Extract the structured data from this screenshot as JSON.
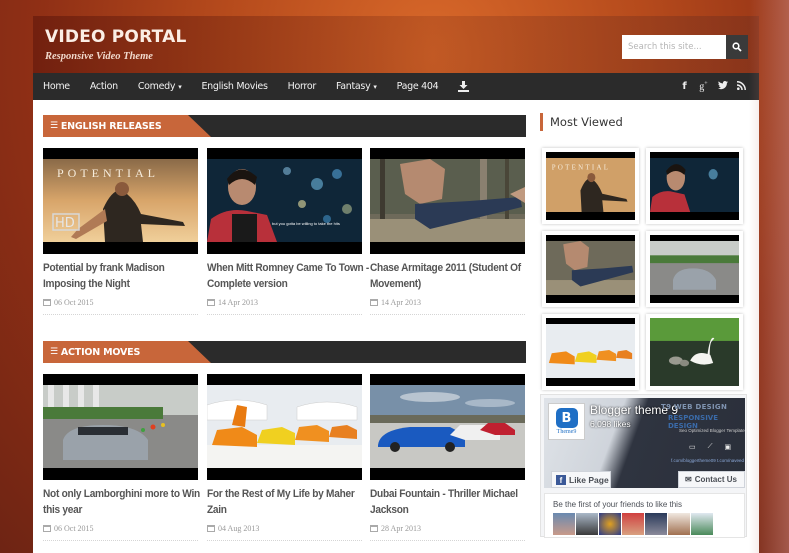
{
  "header": {
    "title": "VIDEO PORTAL",
    "tagline": "Responsive Video Theme",
    "search": {
      "placeholder": "Search this site...",
      "icon": "search-icon"
    }
  },
  "nav": {
    "items": [
      {
        "label": "Home",
        "dropdown": false
      },
      {
        "label": "Action",
        "dropdown": false
      },
      {
        "label": "Comedy",
        "dropdown": true
      },
      {
        "label": "English Movies",
        "dropdown": false
      },
      {
        "label": "Horror",
        "dropdown": false
      },
      {
        "label": "Fantasy",
        "dropdown": true
      },
      {
        "label": "Page 404",
        "dropdown": false
      }
    ],
    "download_icon": "download-icon",
    "caret": "▾",
    "social": [
      {
        "name": "facebook-icon",
        "glyph": "f"
      },
      {
        "name": "google-plus-icon",
        "glyph": "g+"
      },
      {
        "name": "twitter-icon",
        "glyph": "🐦"
      },
      {
        "name": "rss-icon",
        "glyph": "rss"
      }
    ]
  },
  "sections": [
    {
      "title": "ENGLISH RELEASES",
      "posts": [
        {
          "title_line1": "Potential by frank Madison",
          "title_line2": "Imposing the Night",
          "date": "06 Oct 2015",
          "thumb": "potential"
        },
        {
          "title_line1": "When Mitt Romney Came To Town -",
          "title_line2": "Complete version",
          "date": "14 Apr 2013",
          "thumb": "romney"
        },
        {
          "title_line1": "Chase Armitage 2011 (Student Of",
          "title_line2": "Movement)",
          "date": "14 Apr 2013",
          "thumb": "chase"
        }
      ]
    },
    {
      "title": "ACTION MOVES",
      "posts": [
        {
          "title_line1": "Not only Lamborghini more to Win",
          "title_line2": "this year",
          "date": "06 Oct 2015",
          "thumb": "lambo-road"
        },
        {
          "title_line1": "For the Rest of My Life by Maher",
          "title_line2": "Zain",
          "date": "04 Aug 2013",
          "thumb": "lambo-hangar"
        },
        {
          "title_line1": "Dubai Fountain - Thriller Michael",
          "title_line2": "Jackson",
          "date": "28 Apr 2013",
          "thumb": "blue-car"
        }
      ]
    }
  ],
  "sidebar": {
    "most_viewed_title": "Most Viewed",
    "most_viewed": [
      "potential",
      "romney",
      "chase",
      "lambo-road",
      "lambo-hangar",
      "swan"
    ],
    "facebook": {
      "page_name": "Blogger theme 9",
      "likes": "6,098 likes",
      "brand_line1": "T9 WEB DESIGN",
      "brand_line2": "RESPONSIVE DESIGN",
      "brand_sub": "Seo Optimized Blogger Template",
      "brand_links": "f.com/bloggertheme09   t.com/naveed",
      "logo_text": "Theme9",
      "like_label": "Like Page",
      "contact_label": "Contact Us",
      "friends_text": "Be the first of your friends to like this"
    }
  },
  "colors": {
    "accent": "#c8663a",
    "nav_bg": "#2b2b2b",
    "title_text": "#555555",
    "date_text": "#999999"
  }
}
